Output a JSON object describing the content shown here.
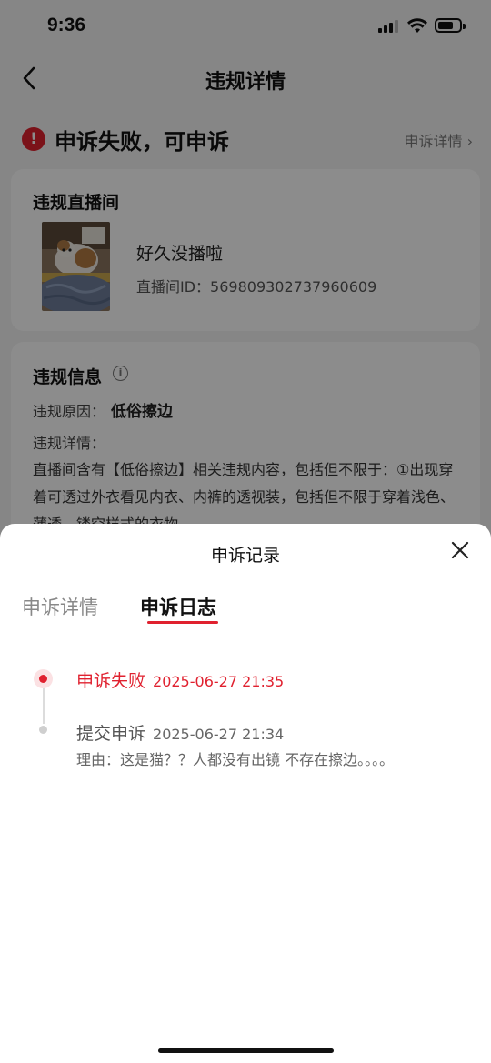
{
  "status_bar": {
    "time": "9:36"
  },
  "nav": {
    "title": "违规详情",
    "back_icon": "chevron-left-icon"
  },
  "status": {
    "alert_glyph": "!",
    "title": "申诉失败，可申诉",
    "link_label": "申诉详情 ›"
  },
  "room_card": {
    "title": "违规直播间",
    "name": "好久没播啦",
    "id_line": "直播间ID：569809302737960609"
  },
  "info_card": {
    "title": "违规信息",
    "info_glyph": "i",
    "reason_label": "违规原因：",
    "reason_value": "低俗擦边",
    "detail_label": "违规详情：",
    "detail_text": "直播间含有【低俗擦边】相关违规内容，包括但不限于：①出现穿着可透过外衣看见内衣、内裤的透视装，包括但不限于穿着浅色、薄透、镂空样式的衣物"
  },
  "sheet": {
    "title": "申诉记录",
    "tabs": [
      {
        "label": "申诉详情",
        "active": false
      },
      {
        "label": "申诉日志",
        "active": true
      }
    ],
    "logs": [
      {
        "label": "申诉失败",
        "date": "2025-06-27 21:35",
        "status": "failed"
      },
      {
        "label": "提交申诉",
        "date": "2025-06-27 21:34",
        "reason": "理由：这是猫？？人都没有出镜 不存在擦边。。。。"
      }
    ]
  },
  "colors": {
    "accent": "#e0212f",
    "overlay": "rgba(0,0,0,0.45)"
  }
}
